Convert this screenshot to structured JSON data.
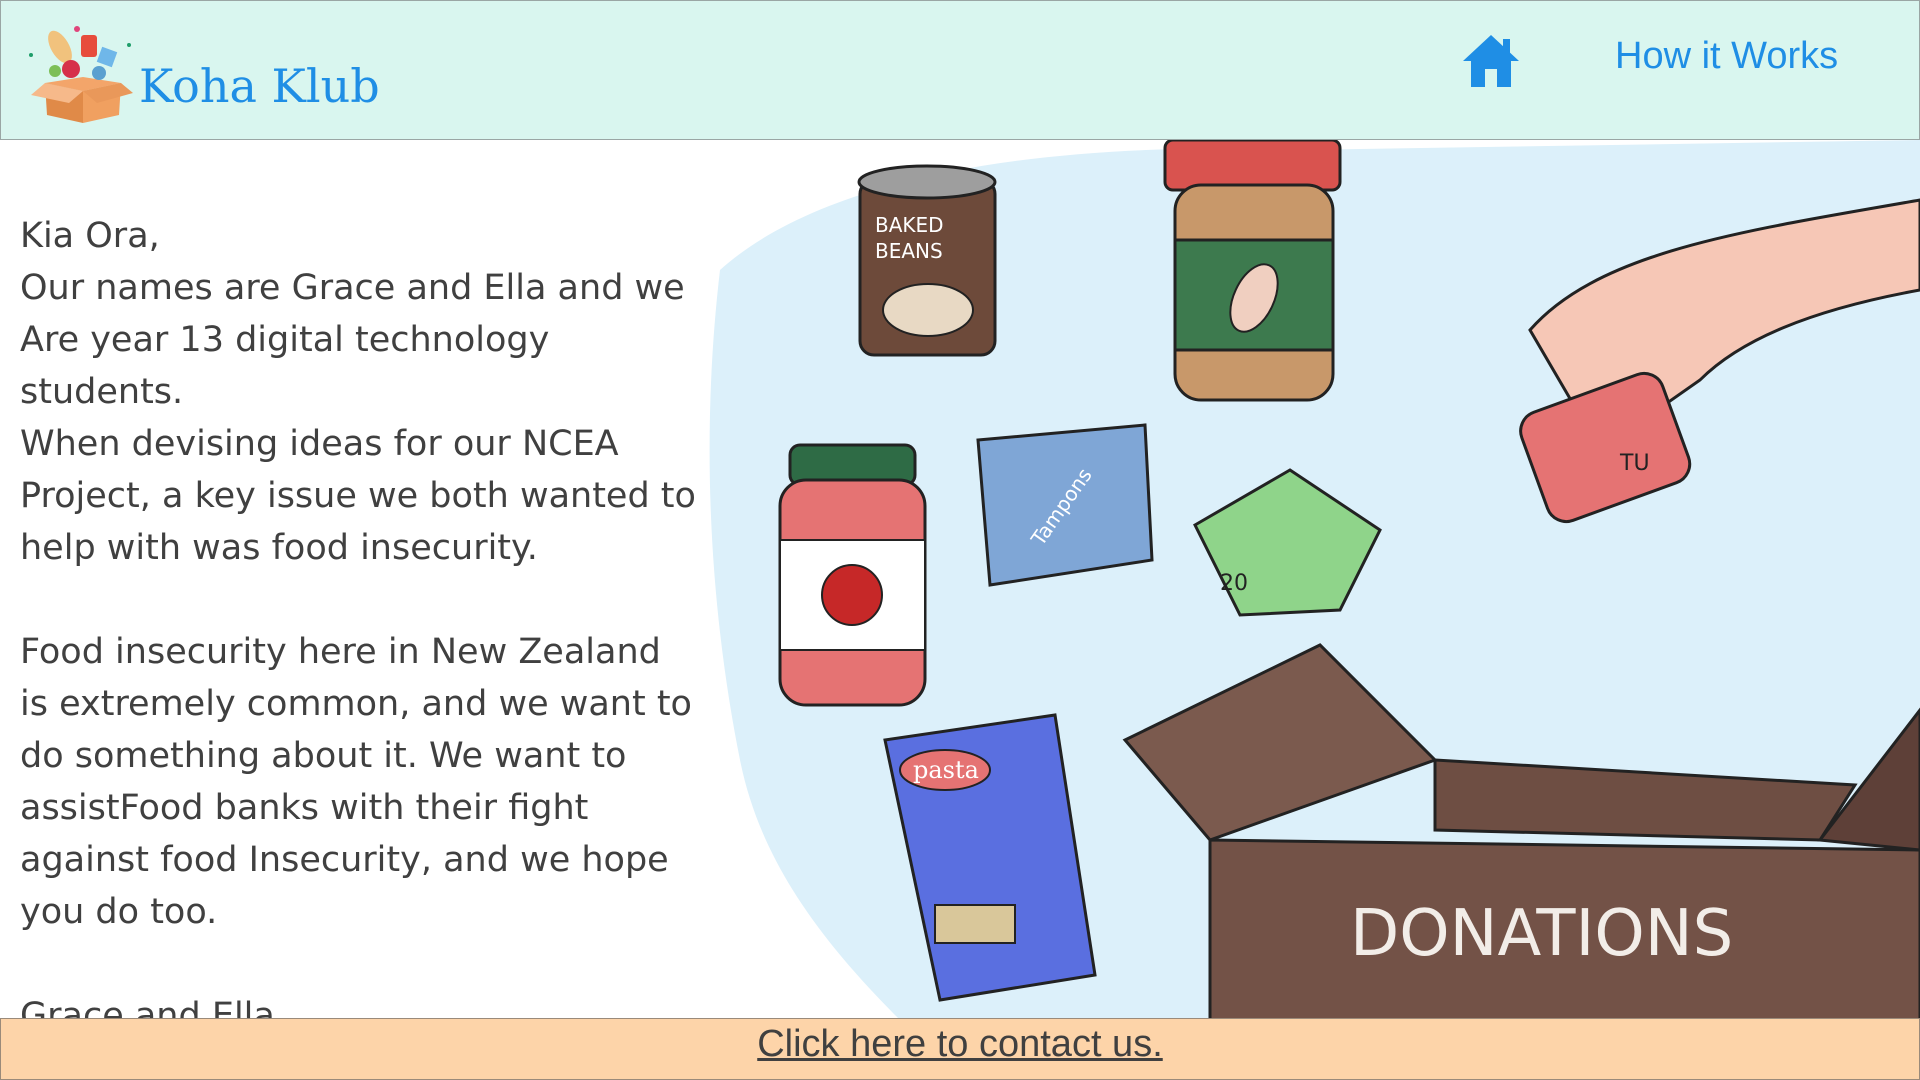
{
  "header": {
    "logo_title": "Koha Klub",
    "nav_link": "How it Works",
    "colors": {
      "background": "#d9f6ef",
      "accent": "#1f8ee5"
    }
  },
  "letter": {
    "text": "Kia Ora,\nOur names are Grace and Ella and we\nAre year 13 digital technology students.\nWhen devising ideas for our NCEA\nProject, a key issue we both wanted to\nhelp with was food insecurity.\n\nFood insecurity here in New Zealand\nis extremely common, and we want to\ndo something about it. We want to\nassistFood banks with their fight\nagainst food Insecurity, and we hope\nyou do too.\n\nGrace and Ella."
  },
  "illustration": {
    "baked_beans_label_1": "BAKED",
    "baked_beans_label_2": "BEANS",
    "tampons_label": "Tampons",
    "pasta_label": "pasta",
    "money_label": "20",
    "tuna_label": "TU",
    "box_label": "DONATIONS"
  },
  "footer": {
    "contact_link": "Click here to contact us.",
    "colors": {
      "background": "#fdd4a9"
    }
  }
}
